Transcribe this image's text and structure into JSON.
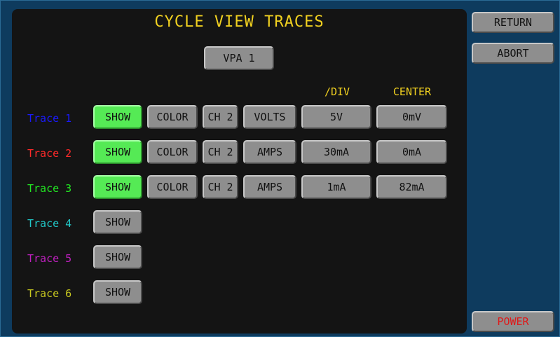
{
  "title": "CYCLE VIEW TRACES",
  "vpa_button": "VPA 1",
  "headers": {
    "div": "/DIV",
    "center": "CENTER"
  },
  "traces": [
    {
      "label": "Trace 1",
      "color": "#1a1aff",
      "show": "SHOW",
      "show_active": true,
      "color_btn": "COLOR",
      "channel": "CH 2",
      "unit": "VOLTS",
      "div": "5V",
      "center": "0mV"
    },
    {
      "label": "Trace 2",
      "color": "#ff2a2a",
      "show": "SHOW",
      "show_active": true,
      "color_btn": "COLOR",
      "channel": "CH 2",
      "unit": "AMPS",
      "div": "30mA",
      "center": "0mA"
    },
    {
      "label": "Trace 3",
      "color": "#22e622",
      "show": "SHOW",
      "show_active": true,
      "color_btn": "COLOR",
      "channel": "CH 2",
      "unit": "AMPS",
      "div": "1mA",
      "center": "82mA"
    },
    {
      "label": "Trace 4",
      "color": "#22c8c8",
      "show": "SHOW",
      "show_active": false
    },
    {
      "label": "Trace 5",
      "color": "#c020c0",
      "show": "SHOW",
      "show_active": false
    },
    {
      "label": "Trace 6",
      "color": "#c8c820",
      "show": "SHOW",
      "show_active": false
    }
  ],
  "side": {
    "return": "RETURN",
    "abort": "ABORT",
    "power": "POWER"
  },
  "colors": {
    "accent": "#f0d020",
    "active_button": "#55ea55",
    "power_text": "#e01818"
  }
}
